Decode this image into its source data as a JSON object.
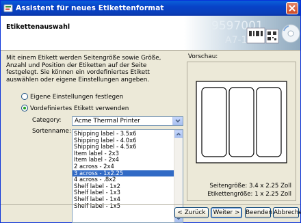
{
  "window": {
    "title": "Assistent für neues Etikettenformat"
  },
  "header": {
    "heading": "Etikettenauswahl",
    "art_text_1": "9597001",
    "art_text_2": "A7-11"
  },
  "intro_text": "Mit einem Etikett werden Seitengröße sowie Größe, Anzahl und Position der Etiketten auf der Seite festgelegt. Sie können ein vordefiniertes Etikett auswählen oder eigene Einstellungen angeben.",
  "options": [
    {
      "label": "Eigene Einstellungen festlegen",
      "checked": false
    },
    {
      "label": "Vordefiniertes Etikett verwenden",
      "checked": true
    }
  ],
  "category": {
    "label": "Category:",
    "value": "Acme Thermal Printer"
  },
  "sortenname": {
    "label": "Sortenname:",
    "items": [
      "Shipping label - 3.5x6",
      "Shipping label - 4.0x6",
      "Shipping label - 4.5x6",
      "Item label - 2x3",
      "Item label - 2x4",
      "2 across - 2x4",
      "3 across - 1x2.25",
      "4 across - .8x2",
      "Shelf label - 1x2",
      "Shelf label - 1x3",
      "Shelf label - 1x4",
      "Shelf label - 1x5"
    ],
    "selected_index": 6
  },
  "preview": {
    "label": "Vorschau:",
    "page_size": "Seitengröße:  3.4 x 2.25 Zoll",
    "label_size": "Etikettengröße:  1 x 2.25 Zoll",
    "columns": 3
  },
  "buttons": {
    "back": "< Zurück",
    "next": "Weiter >",
    "finish": "Beenden",
    "cancel": "Abbrechen"
  },
  "colors": {
    "titlebar": "#0a4fd0",
    "selection": "#316ac5",
    "dialog_bg": "#ece9d8"
  }
}
